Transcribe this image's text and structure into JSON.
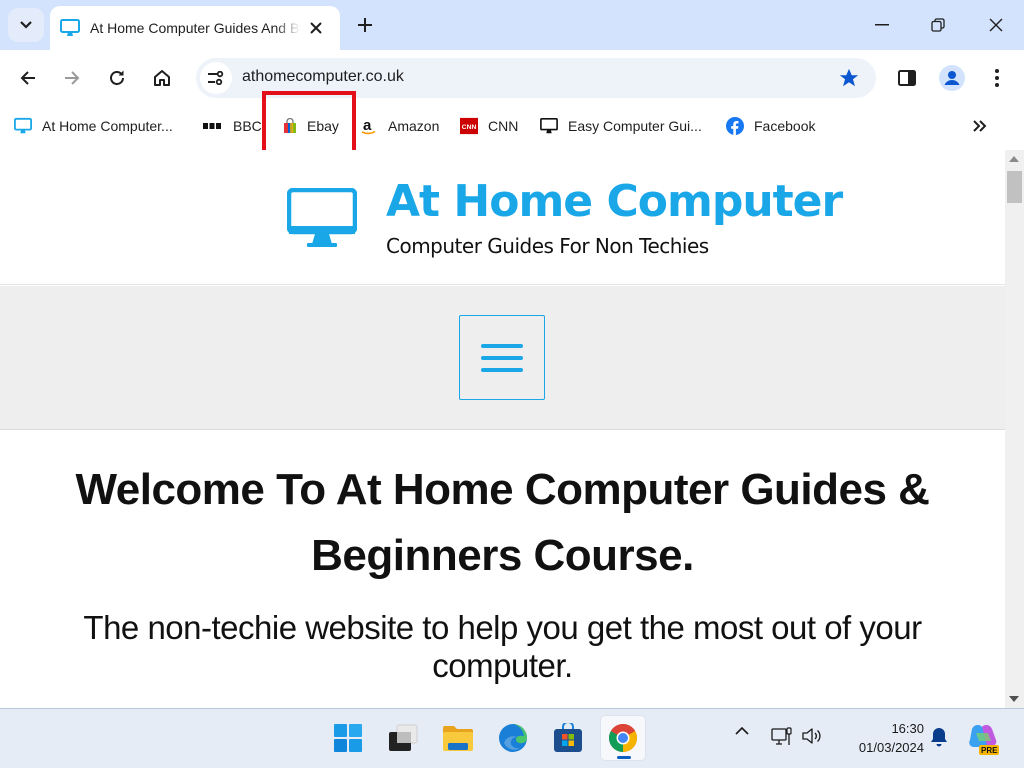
{
  "browser": {
    "tab": {
      "title": "At Home Computer Guides And Beginners Course",
      "favicon": "monitor-icon"
    },
    "tab_search_icon": "chevron-down-icon",
    "new_tab_icon": "plus-icon",
    "window_controls": {
      "minimize": "minimize-icon",
      "restore": "restore-icon",
      "close": "close-icon"
    },
    "toolbar": {
      "back": "back-arrow-icon",
      "forward": "forward-arrow-icon",
      "reload": "reload-icon",
      "home": "home-icon",
      "url": "athomecomputer.co.uk",
      "site_info_icon": "tune-icon",
      "bookmark_star": "star-filled-icon",
      "side_panel": "side-panel-icon",
      "profile": "profile-icon",
      "menu": "kebab-menu-icon"
    },
    "bookmarks": [
      {
        "label": "At Home Computer...",
        "icon": "monitor-icon"
      },
      {
        "label": "BBC",
        "icon": "bbc-icon"
      },
      {
        "label": "Ebay",
        "icon": "shopping-bag-icon"
      },
      {
        "label": "Amazon",
        "icon": "amazon-icon"
      },
      {
        "label": "CNN",
        "icon": "cnn-icon"
      },
      {
        "label": "Easy Computer Gui...",
        "icon": "monitor-icon"
      },
      {
        "label": "Facebook",
        "icon": "facebook-icon"
      }
    ],
    "bookmarks_overflow_icon": "double-chevron-icon",
    "highlight_color": "#e3101a"
  },
  "page": {
    "site_title": "At Home Computer",
    "site_tagline": "Computer Guides For Non Techies",
    "menu_button_icon": "hamburger-icon",
    "heading": "Welcome To At Home Computer Guides & Beginners Course.",
    "subheading": "The non-techie website to help you get the most out of your computer.",
    "accent_color": "#1aa7e8"
  },
  "taskbar": {
    "apps": [
      {
        "name": "Start",
        "icon": "windows-start-icon"
      },
      {
        "name": "Task View",
        "icon": "task-view-icon"
      },
      {
        "name": "File Explorer",
        "icon": "folder-icon"
      },
      {
        "name": "Microsoft Edge",
        "icon": "edge-icon"
      },
      {
        "name": "Microsoft Store",
        "icon": "store-icon"
      },
      {
        "name": "Google Chrome",
        "icon": "chrome-icon",
        "active": true
      }
    ],
    "tray": {
      "overflow_icon": "chevron-up-icon",
      "network_icon": "network-icon",
      "volume_icon": "volume-icon",
      "time": "16:30",
      "date": "01/03/2024",
      "notification_icon": "bell-icon",
      "copilot_icon": "copilot-icon",
      "copilot_badge": "PRE"
    }
  }
}
